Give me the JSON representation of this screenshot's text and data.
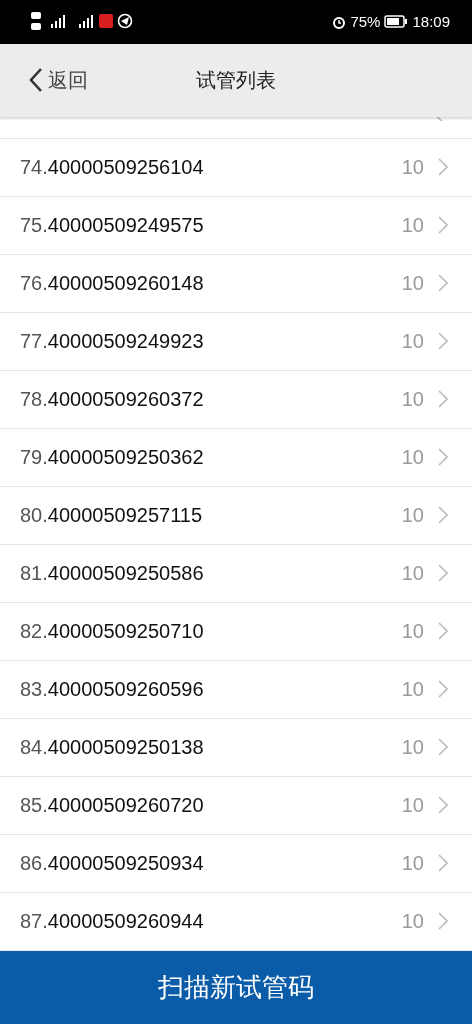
{
  "status_bar": {
    "battery": "75%",
    "time": "18:09"
  },
  "header": {
    "back": "返回",
    "title": "试管列表"
  },
  "rows": [
    {
      "index": "74.",
      "code": "40000509256104",
      "count": "10"
    },
    {
      "index": "75.",
      "code": "40000509249575",
      "count": "10"
    },
    {
      "index": "76.",
      "code": "40000509260148",
      "count": "10"
    },
    {
      "index": "77.",
      "code": "40000509249923",
      "count": "10"
    },
    {
      "index": "78.",
      "code": "40000509260372",
      "count": "10"
    },
    {
      "index": "79.",
      "code": "40000509250362",
      "count": "10"
    },
    {
      "index": "80.",
      "code": "40000509257115",
      "count": "10"
    },
    {
      "index": "81.",
      "code": "40000509250586",
      "count": "10"
    },
    {
      "index": "82.",
      "code": "40000509250710",
      "count": "10"
    },
    {
      "index": "83.",
      "code": "40000509260596",
      "count": "10"
    },
    {
      "index": "84.",
      "code": "40000509250138",
      "count": "10"
    },
    {
      "index": "85.",
      "code": "40000509260720",
      "count": "10"
    },
    {
      "index": "86.",
      "code": "40000509250934",
      "count": "10"
    },
    {
      "index": "87.",
      "code": "40000509260944",
      "count": "10"
    }
  ],
  "scan_button": "扫描新试管码"
}
